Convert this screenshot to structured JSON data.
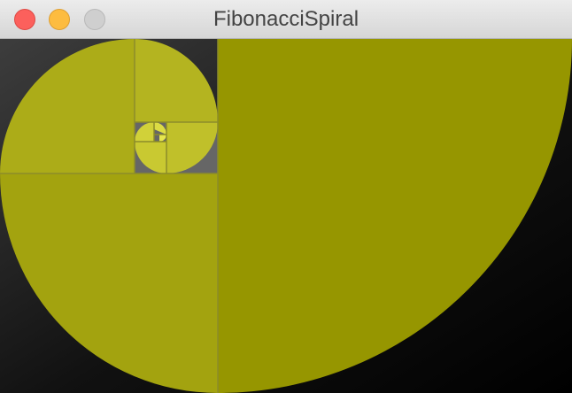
{
  "window": {
    "title": "FibonacciSpiral"
  },
  "colors": {
    "background_gradient": [
      "#3d3d3d",
      "#000000"
    ],
    "titlebar": "#e0e0e0",
    "spiral_fills": [
      "#969600",
      "#a3a30f",
      "#b2b21e",
      "#bcbc26",
      "#c6c62e",
      "#d2d23a",
      "#dcdc44",
      "#e6e64e"
    ],
    "square_lines": "#8c8c2a",
    "inner_squares_background": "#666666"
  },
  "icons": {
    "close": "close-icon",
    "minimize": "minimize-icon",
    "zoom": "zoom-icon"
  },
  "spiral": {
    "sequence": [
      1,
      1,
      2,
      3,
      5,
      8,
      13,
      21,
      34
    ]
  }
}
